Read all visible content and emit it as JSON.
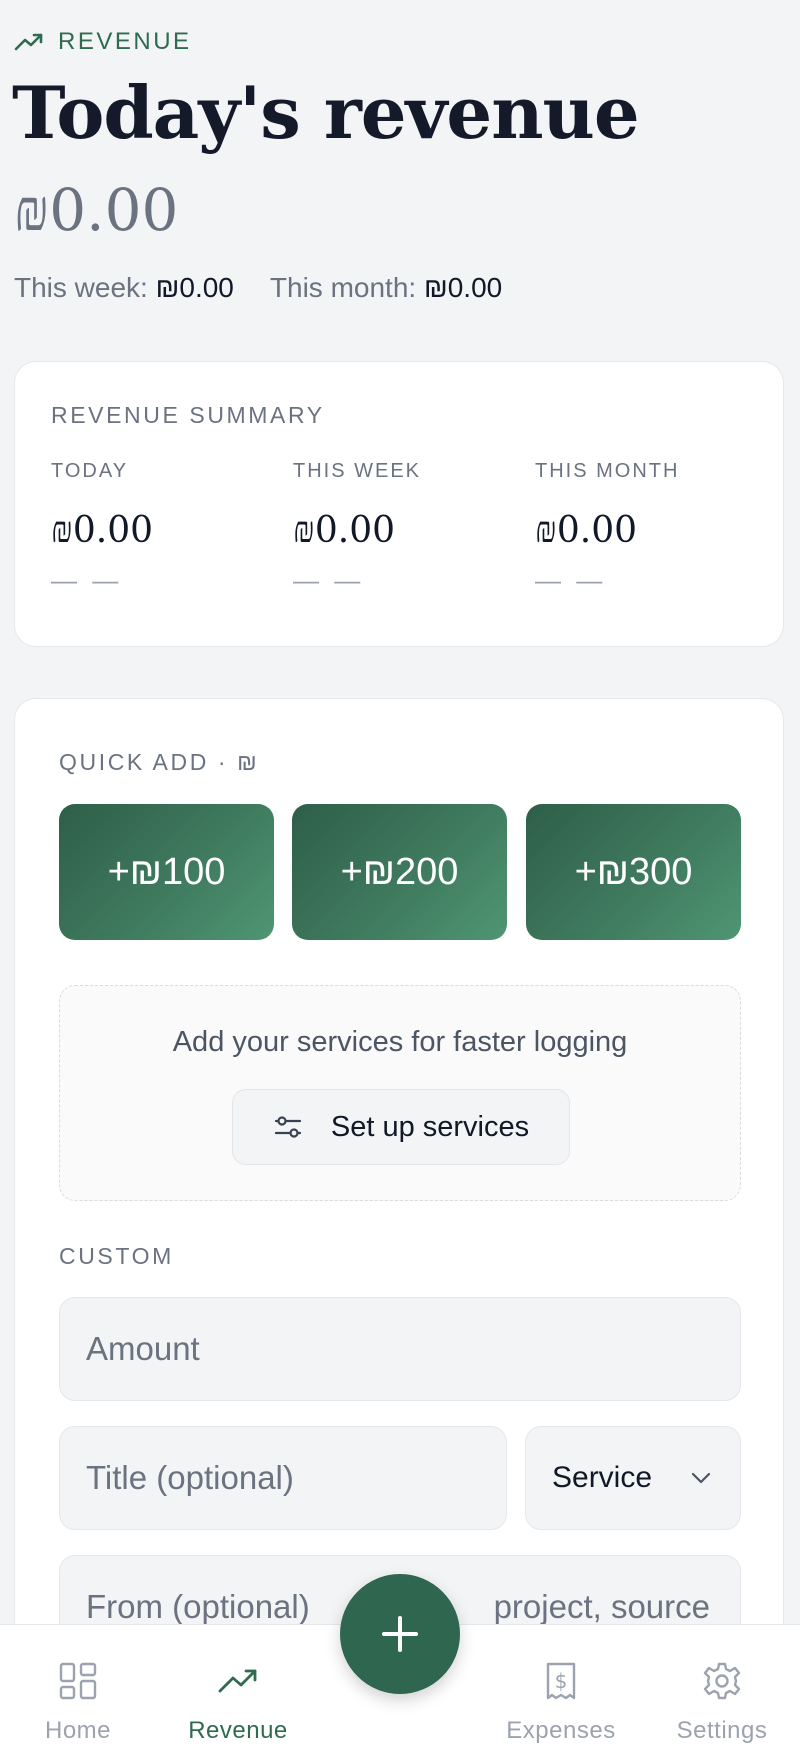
{
  "header": {
    "eyebrow": "REVENUE",
    "title": "Today's revenue",
    "today_amount": "₪0.00",
    "week_label": "This week:",
    "week_value": "₪0.00",
    "month_label": "This month:",
    "month_value": "₪0.00"
  },
  "summary": {
    "label": "REVENUE SUMMARY",
    "columns": [
      {
        "key": "TODAY",
        "value": "₪0.00",
        "delta": "— —"
      },
      {
        "key": "THIS WEEK",
        "value": "₪0.00",
        "delta": "— —"
      },
      {
        "key": "THIS MONTH",
        "value": "₪0.00",
        "delta": "— —"
      }
    ]
  },
  "quick_add": {
    "label": "QUICK ADD · ₪",
    "buttons": [
      "+₪100",
      "+₪200",
      "+₪300"
    ],
    "services_hint": "Add your services for faster logging",
    "setup_button": "Set up services"
  },
  "custom": {
    "label": "CUSTOM",
    "amount_placeholder": "Amount",
    "title_placeholder": "Title (optional)",
    "service_select": "Service",
    "from_placeholder": "From (optional)",
    "from_right_text": "project, source"
  },
  "nav": {
    "items": [
      {
        "label": "Home",
        "icon": "grid-icon"
      },
      {
        "label": "Revenue",
        "icon": "trending-up-icon"
      },
      {
        "label": "Expenses",
        "icon": "receipt-icon"
      },
      {
        "label": "Settings",
        "icon": "gear-icon"
      }
    ],
    "active": "Revenue",
    "fab_icon": "plus-icon"
  },
  "colors": {
    "accent": "#2f6b4f",
    "background": "#f3f4f6",
    "card": "#ffffff"
  }
}
